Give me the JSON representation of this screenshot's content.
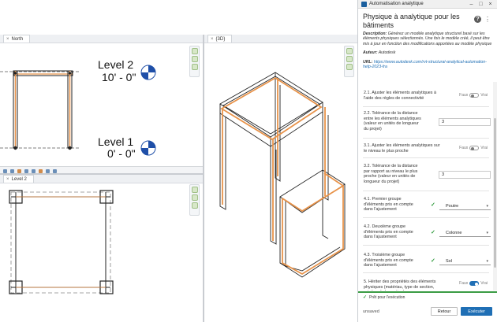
{
  "left_views": {
    "top_left": {
      "tab_label": "North"
    },
    "bottom_left": {
      "tab_label": "Level 2"
    },
    "right": {
      "tab_label": "{3D}"
    },
    "levels": [
      {
        "name": "Level 2",
        "elevation": "10' - 0\""
      },
      {
        "name": "Level 1",
        "elevation": "0' - 0\""
      }
    ],
    "colors": {
      "analytical": "#e8934a",
      "physical": "#333333",
      "level_marker": "#1f4fa8"
    }
  },
  "panel": {
    "window_title": "Automatisation analytique",
    "heading": "Physique à analytique pour les bâtiments",
    "description_label": "Description:",
    "description_text": "Générez un modèle analytique structurel basé sur les éléments physiques sélectionnés. Une fois le modèle créé, il peut être mis à jour en fonction des modifications apportées au modèle physique",
    "author_label": "Auteur:",
    "author_value": "Autodesk",
    "url_label": "URL:",
    "url_value": "https://www.autodesk.com/rvt-structural-analytical-automation-help-2023-fra",
    "rows": [
      {
        "label": "2.1. Ajuster les éléments analytiques à l'aide des règles de connectivité",
        "off": "Faux",
        "on": "Vrai"
      },
      {
        "label": "2.2. Tolérance de la distance entre les éléments analytiques (valeur en unités de longueur du projet)",
        "value": "3"
      },
      {
        "label": "3.1. Ajuster les éléments analytiques sur le niveau le plus proche",
        "off": "Faux",
        "on": "Vrai"
      },
      {
        "label": "3.2. Tolérance de la distance par rapport au niveau le plus proche (valeur en unités de longueur du projet)",
        "value": "3"
      },
      {
        "label": "4.1. Premier groupe d'éléments pris en compte dans l'ajustement",
        "selected": "Poutre"
      },
      {
        "label": "4.2. Deuxième groupe d'éléments pris en compte dans l'ajustement",
        "selected": "Colonne"
      },
      {
        "label": "4.3. Troisième groupe d'éléments pris en compte dans l'ajustement",
        "selected": "Sol"
      },
      {
        "label": "5. Hériter des propriétés des éléments physiques (matériau, type de section, rotation de la section)",
        "off": "Faux",
        "on": "Vrai"
      }
    ],
    "status": "Prêt pour l'exécution",
    "unsaved": "unsaved",
    "back_label": "Retour",
    "run_label": "Exécuter",
    "accent_color": "#1f6fb5",
    "ok_color": "#3b9c45"
  }
}
